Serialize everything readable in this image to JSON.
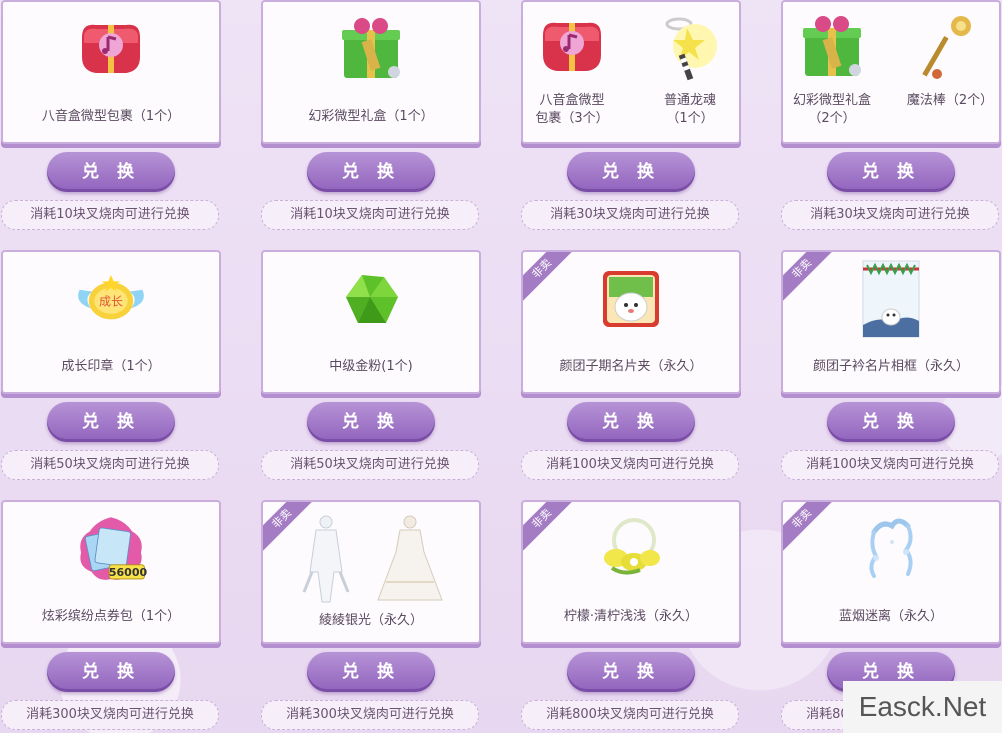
{
  "buttons": {
    "exchange_label": "兑 换"
  },
  "badge_label": "非卖",
  "watermark": "Easck.Net",
  "cards": [
    {
      "items": [
        {
          "label": "八音盒微型包裹（1个）",
          "icon": "music-box-icon"
        }
      ],
      "cost": "消耗10块叉烧肉可进行兑换",
      "badge": false
    },
    {
      "items": [
        {
          "label": "幻彩微型礼盒（1个）",
          "icon": "gift-box-icon"
        }
      ],
      "cost": "消耗10块叉烧肉可进行兑换",
      "badge": false
    },
    {
      "items": [
        {
          "label": "八音盒微型\n包裹（3个）",
          "icon": "music-box-icon"
        },
        {
          "label": "普通龙魂\n（1个）",
          "icon": "dragon-soul-icon"
        }
      ],
      "cost": "消耗30块叉烧肉可进行兑换",
      "badge": false
    },
    {
      "items": [
        {
          "label": "幻彩微型礼盒\n（2个）",
          "icon": "gift-box-icon"
        },
        {
          "label": "魔法棒（2个）",
          "icon": "magic-wand-icon"
        }
      ],
      "cost": "消耗30块叉烧肉可进行兑换",
      "badge": false
    },
    {
      "items": [
        {
          "label": "成长印章（1个）",
          "icon": "growth-seal-icon"
        }
      ],
      "cost": "消耗50块叉烧肉可进行兑换",
      "badge": false
    },
    {
      "items": [
        {
          "label": "中级金粉(1个)",
          "icon": "green-crystal-icon"
        }
      ],
      "cost": "消耗50块叉烧肉可进行兑换",
      "badge": false
    },
    {
      "items": [
        {
          "label": "颜团子期名片夹（永久）",
          "icon": "card-holder-icon"
        }
      ],
      "cost": "消耗100块叉烧肉可进行兑换",
      "badge": true
    },
    {
      "items": [
        {
          "label": "颜团子衿名片相框（永久）",
          "icon": "photo-frame-icon"
        }
      ],
      "cost": "消耗100块叉烧肉可进行兑换",
      "badge": true
    },
    {
      "items": [
        {
          "label": "炫彩缤纷点券包（1个）",
          "icon": "coupon-pack-icon",
          "amount": "56000"
        }
      ],
      "cost": "消耗300块叉烧肉可进行兑换",
      "badge": false
    },
    {
      "items": [
        {
          "label": "綾綾银光（永久）",
          "icon": "outfit-icon"
        }
      ],
      "cost": "消耗300块叉烧肉可进行兑换",
      "badge": true
    },
    {
      "items": [
        {
          "label": "柠檬·清柠浅浅（永久）",
          "icon": "lemon-accessory-icon"
        }
      ],
      "cost": "消耗800块叉烧肉可进行兑换",
      "badge": true
    },
    {
      "items": [
        {
          "label": "蓝烟迷离（永久）",
          "icon": "blue-smoke-icon"
        }
      ],
      "cost": "消耗800块叉烧肉可进行兑换",
      "badge": true
    }
  ]
}
